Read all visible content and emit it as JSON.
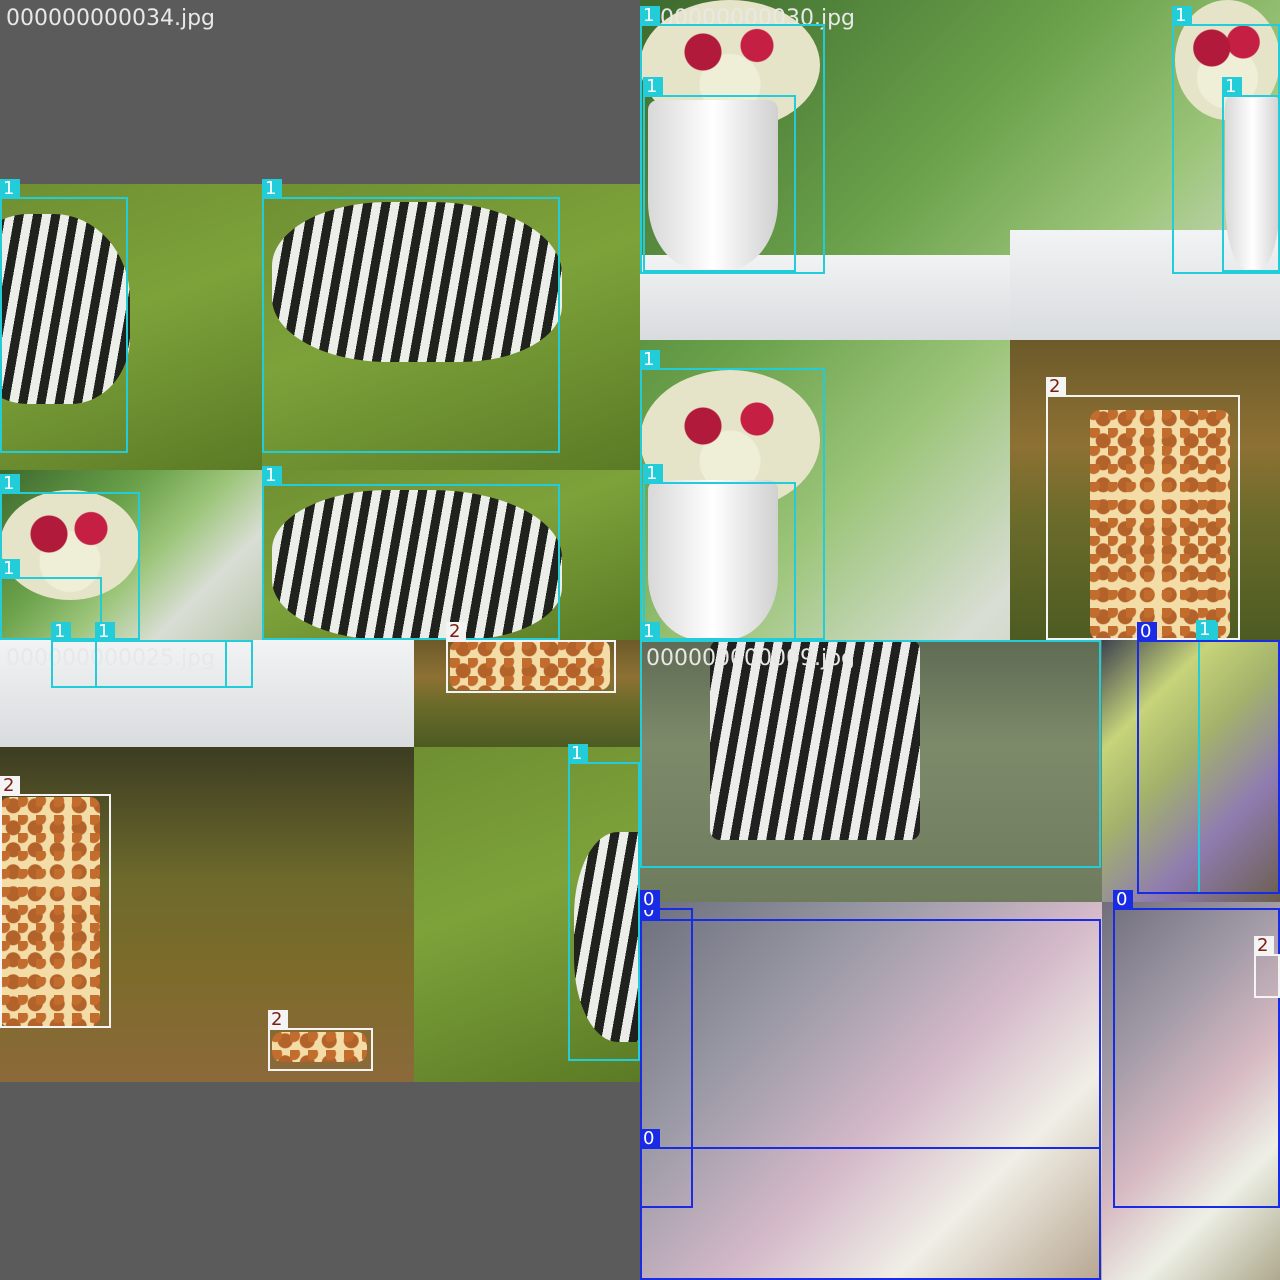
{
  "tiles": [
    {
      "label": "000000000034.jpg"
    },
    {
      "label": "000000000030.jpg"
    },
    {
      "label": "000000000025.jpg"
    },
    {
      "label": "000000000009.jpg"
    }
  ],
  "class_colors": {
    "0": "#1a2be6",
    "1": "#22ccd8",
    "2": "#f4f4f4"
  },
  "boxes": [
    {
      "cls": "1"
    },
    {
      "cls": "1"
    },
    {
      "cls": "1"
    },
    {
      "cls": "1"
    },
    {
      "cls": "1"
    },
    {
      "cls": "1"
    },
    {
      "cls": "1"
    },
    {
      "cls": "1"
    },
    {
      "cls": "1"
    },
    {
      "cls": "1"
    },
    {
      "cls": "1"
    },
    {
      "cls": "1"
    },
    {
      "cls": "1"
    },
    {
      "cls": "1"
    },
    {
      "cls": "2"
    },
    {
      "cls": "2"
    },
    {
      "cls": "2"
    },
    {
      "cls": "2"
    },
    {
      "cls": "1"
    },
    {
      "cls": "1"
    },
    {
      "cls": "0"
    },
    {
      "cls": "0"
    },
    {
      "cls": "0"
    },
    {
      "cls": "0"
    },
    {
      "cls": "0"
    },
    {
      "cls": "1"
    },
    {
      "cls": "2"
    }
  ]
}
